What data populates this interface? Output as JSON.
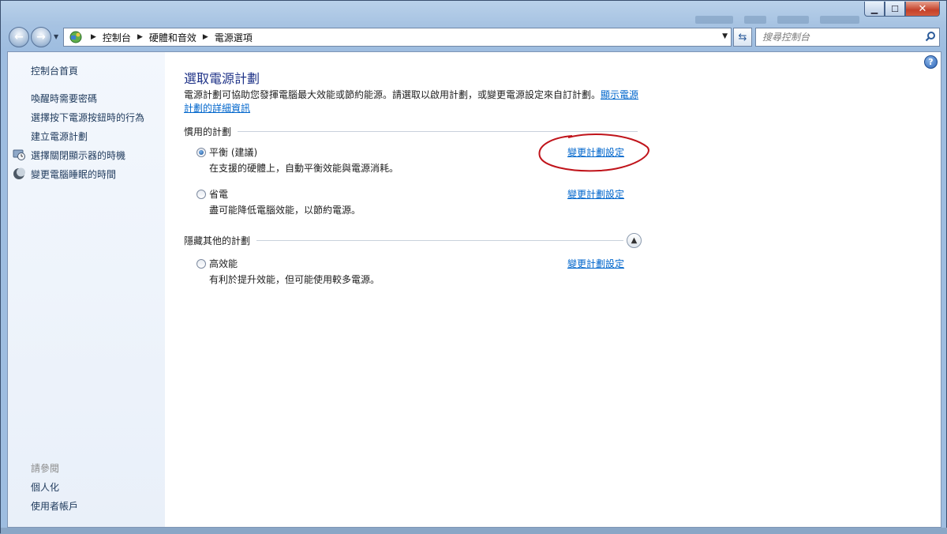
{
  "window": {
    "caption": {
      "minimize": "▁",
      "maximize": "☐",
      "close": "✕"
    }
  },
  "nav": {
    "back_icon": "back-arrow-icon",
    "forward_icon": "forward-arrow-icon",
    "breadcrumbs": [
      "控制台",
      "硬體和音效",
      "電源選項"
    ],
    "search_placeholder": "搜尋控制台"
  },
  "sidebar": {
    "home": "控制台首頁",
    "items": [
      {
        "label": "喚醒時需要密碼"
      },
      {
        "label": "選擇按下電源按鈕時的行為"
      },
      {
        "label": "建立電源計劃"
      },
      {
        "label": "選擇關閉顯示器的時機",
        "icon": "monitor-clock-icon"
      },
      {
        "label": "變更電腦睡眠的時間",
        "icon": "moon-icon"
      }
    ],
    "see_also_title": "請參閱",
    "see_also": [
      "個人化",
      "使用者帳戶"
    ]
  },
  "main": {
    "title": "選取電源計劃",
    "description": "電源計劃可協助您發揮電腦最大效能或節約能源。請選取以啟用計劃，或變更電源設定來自訂計劃。",
    "description_link": "顯示電源計劃的詳細資訊",
    "preferred_group": "慣用的計劃",
    "hidden_group": "隱藏其他的計劃",
    "change_label": "變更計劃設定",
    "plans": [
      {
        "name": "平衡 (建議)",
        "desc": "在支援的硬體上，自動平衡效能與電源消耗。",
        "selected": true
      },
      {
        "name": "省電",
        "desc": "盡可能降低電腦效能，以節約電源。",
        "selected": false
      },
      {
        "name": "高效能",
        "desc": "有利於提升效能，但可能使用較多電源。",
        "selected": false
      }
    ]
  },
  "colors": {
    "link": "#0066cc",
    "title": "#1e3287",
    "annotation": "#c0141b"
  }
}
